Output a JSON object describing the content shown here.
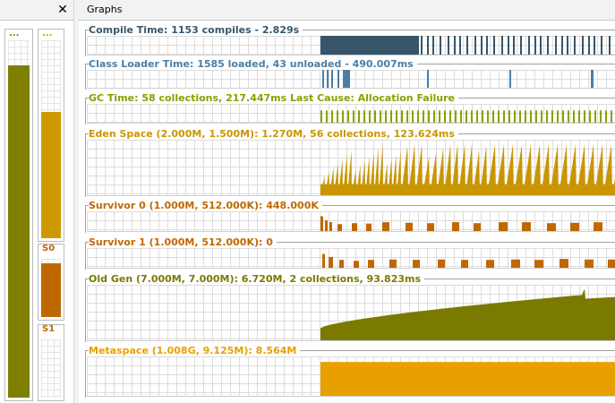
{
  "tabs": {
    "graphs_label": "Graphs",
    "close_glyph": "✕"
  },
  "gauges": [
    {
      "key": "old",
      "label": "...",
      "level": 0.93,
      "color": "#7f7f00"
    },
    {
      "key": "eden",
      "label": "...",
      "level": 0.64,
      "color": "#cc9a00"
    },
    {
      "key": "s0",
      "label": "S0",
      "level": 0.93,
      "color": "#c06800"
    },
    {
      "key": "s1",
      "label": "S1",
      "level": 0.0,
      "color": "#c06800"
    }
  ],
  "graphs": [
    {
      "key": "compile",
      "title": "Compile Time: 1153 compiles - 2.829s",
      "color": "#37566b"
    },
    {
      "key": "classloader",
      "title": "Class Loader Time: 1585 loaded, 43 unloaded - 490.007ms",
      "color": "#4a7ea6"
    },
    {
      "key": "gc",
      "title": "GC Time: 58 collections, 217.447ms Last Cause: Allocation Failure",
      "color": "#8aa000"
    },
    {
      "key": "eden",
      "title": "Eden Space (2.000M, 1.500M): 1.270M, 56 collections, 123.624ms",
      "color": "#c99500"
    },
    {
      "key": "s0",
      "title": "Survivor 0 (1.000M, 512.000K): 448.000K",
      "color": "#c06800"
    },
    {
      "key": "s1",
      "title": "Survivor 1 (1.000M, 512.000K): 0",
      "color": "#c06800"
    },
    {
      "key": "oldgen",
      "title": "Old Gen (7.000M, 7.000M): 6.720M, 2 collections, 93.823ms",
      "color": "#7a7a00"
    },
    {
      "key": "meta",
      "title": "Metaspace (1.008G, 9.125M): 8.564M",
      "color": "#e8a000"
    }
  ]
}
